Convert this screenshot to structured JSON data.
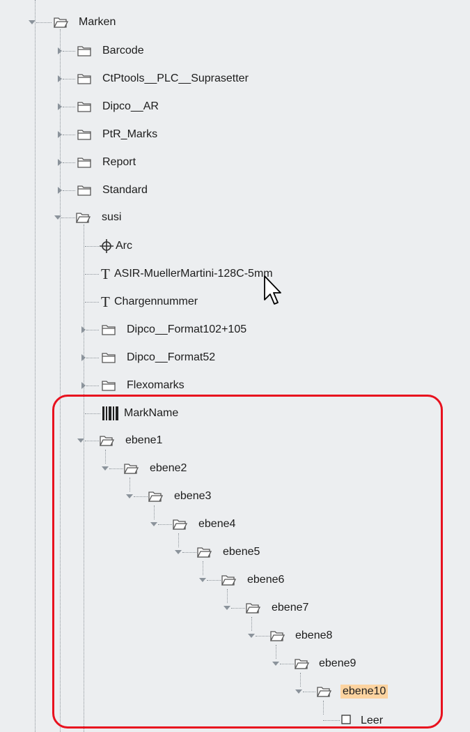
{
  "tree": {
    "nodes": [
      {
        "id": "marken",
        "label": "Marken",
        "icon": "folder-open-icon",
        "toggle": "expanded"
      },
      {
        "id": "barcode",
        "label": "Barcode",
        "icon": "folder-icon",
        "toggle": "collapsed"
      },
      {
        "id": "ctptools",
        "label": "CtPtools__PLC__Suprasetter",
        "icon": "folder-icon",
        "toggle": "collapsed"
      },
      {
        "id": "dipco-ar",
        "label": "Dipco__AR",
        "icon": "folder-icon",
        "toggle": "collapsed"
      },
      {
        "id": "ptr-marks",
        "label": "PtR_Marks",
        "icon": "folder-icon",
        "toggle": "collapsed"
      },
      {
        "id": "report",
        "label": "Report",
        "icon": "folder-icon",
        "toggle": "collapsed"
      },
      {
        "id": "standard",
        "label": "Standard",
        "icon": "folder-icon",
        "toggle": "collapsed"
      },
      {
        "id": "susi",
        "label": "susi",
        "icon": "folder-open-icon",
        "toggle": "expanded"
      },
      {
        "id": "arc",
        "label": "Arc",
        "icon": "crosshair-icon",
        "toggle": "none"
      },
      {
        "id": "asir",
        "label": "ASIR-MuellerMartini-128C-5mm",
        "icon": "text-t-icon",
        "toggle": "none"
      },
      {
        "id": "chargennummer",
        "label": "Chargennummer",
        "icon": "text-t-icon",
        "toggle": "none"
      },
      {
        "id": "dipco-format102",
        "label": "Dipco__Format102+105",
        "icon": "folder-icon",
        "toggle": "collapsed"
      },
      {
        "id": "dipco-format52",
        "label": "Dipco__Format52",
        "icon": "folder-icon",
        "toggle": "collapsed"
      },
      {
        "id": "flexomarks",
        "label": "Flexomarks",
        "icon": "folder-icon",
        "toggle": "collapsed"
      },
      {
        "id": "markname",
        "label": "MarkName",
        "icon": "barcode-icon",
        "toggle": "none"
      },
      {
        "id": "ebene1",
        "label": "ebene1",
        "icon": "folder-open-icon",
        "toggle": "expanded"
      },
      {
        "id": "ebene2",
        "label": "ebene2",
        "icon": "folder-open-icon",
        "toggle": "expanded"
      },
      {
        "id": "ebene3",
        "label": "ebene3",
        "icon": "folder-open-icon",
        "toggle": "expanded"
      },
      {
        "id": "ebene4",
        "label": "ebene4",
        "icon": "folder-open-icon",
        "toggle": "expanded"
      },
      {
        "id": "ebene5",
        "label": "ebene5",
        "icon": "folder-open-icon",
        "toggle": "expanded"
      },
      {
        "id": "ebene6",
        "label": "ebene6",
        "icon": "folder-open-icon",
        "toggle": "expanded"
      },
      {
        "id": "ebene7",
        "label": "ebene7",
        "icon": "folder-open-icon",
        "toggle": "expanded"
      },
      {
        "id": "ebene8",
        "label": "ebene8",
        "icon": "folder-open-icon",
        "toggle": "expanded"
      },
      {
        "id": "ebene9",
        "label": "ebene9",
        "icon": "folder-open-icon",
        "toggle": "expanded"
      },
      {
        "id": "ebene10",
        "label": "ebene10",
        "icon": "folder-open-icon",
        "toggle": "expanded",
        "selected": true
      },
      {
        "id": "leer",
        "label": "Leer",
        "icon": "empty-box-icon",
        "toggle": "none"
      }
    ]
  },
  "colors": {
    "panel_bg": "#eceef0",
    "selection": "#fcd3a0",
    "highlight_border": "#e8111e",
    "toggle": "#8b939b"
  }
}
